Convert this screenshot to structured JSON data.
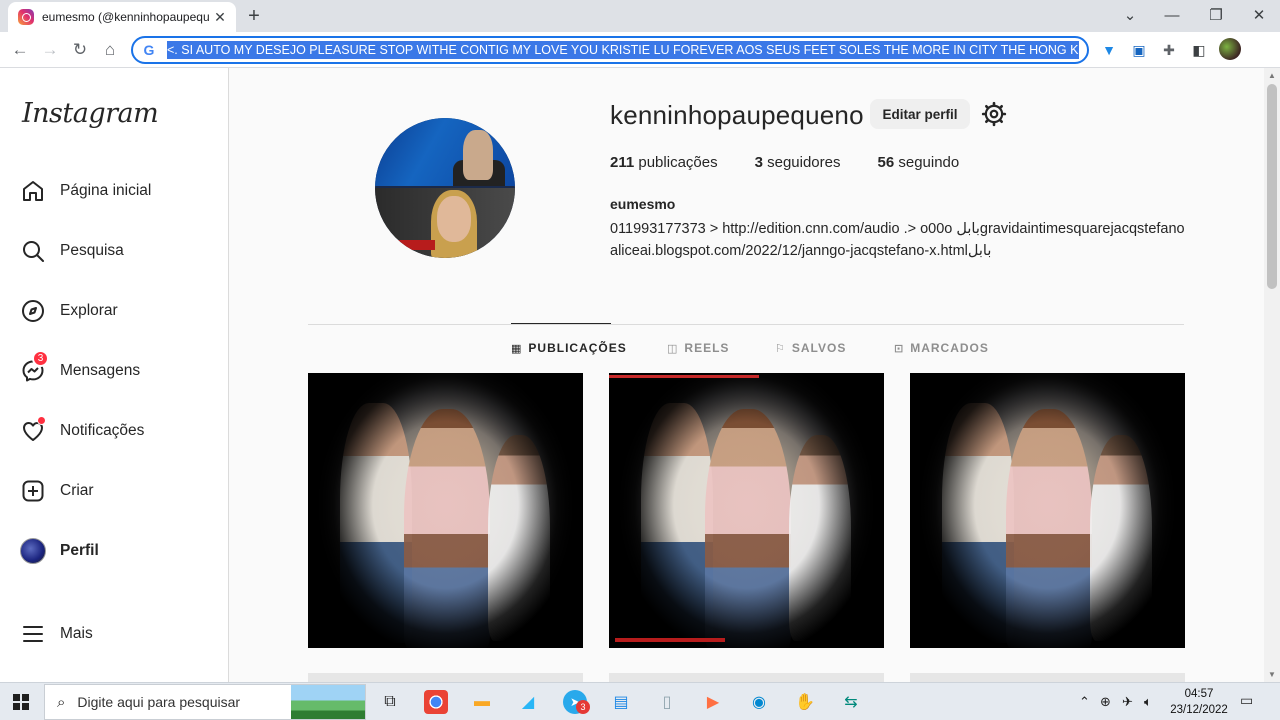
{
  "browser": {
    "tab_title": "eumesmo (@kenninhopaupeque",
    "tab_close": "✕",
    "new_tab": "+",
    "address": "<. SI AUTO MY DESEJO PLEASURE STOP WITHE CONTIG MY LOVE YOU KRISTIE LU FOREVER AOS SEUS FEET SOLES THE MORE IN CITY THE HONG KONG PRIN",
    "g_letter": "G"
  },
  "sidebar": {
    "logo": "Instagram",
    "items": [
      {
        "label": "Página inicial",
        "icon": "home-icon"
      },
      {
        "label": "Pesquisa",
        "icon": "search-icon"
      },
      {
        "label": "Explorar",
        "icon": "compass-icon"
      },
      {
        "label": "Mensagens",
        "icon": "messenger-icon",
        "badge": "3"
      },
      {
        "label": "Notificações",
        "icon": "heart-icon"
      },
      {
        "label": "Criar",
        "icon": "plus-square-icon"
      },
      {
        "label": "Perfil",
        "icon": "avatar"
      },
      {
        "label": "Mais",
        "icon": "menu-icon"
      }
    ]
  },
  "profile": {
    "username": "kenninhopaupequeno",
    "edit_button": "Editar perfil",
    "stats": {
      "posts_count": "211",
      "posts_label": "publicações",
      "followers_count": "3",
      "followers_label": "seguidores",
      "following_count": "56",
      "following_label": "seguindo"
    },
    "full_name": "eumesmo",
    "bio": "011993177373 > http://edition.cnn.com/audio .> o00o بابلgravidaintimesquarejacqstefanoaliceai.blogspot.com/2022/12/janngo-jacqstefano-x.htmlبابل"
  },
  "tabs": [
    {
      "label": "PUBLICAÇÕES",
      "icon": "▦",
      "active": true
    },
    {
      "label": "REELS",
      "icon": "◫",
      "active": false
    },
    {
      "label": "SALVOS",
      "icon": "⚐",
      "active": false
    },
    {
      "label": "MARCADOS",
      "icon": "⊡",
      "active": false
    }
  ],
  "taskbar": {
    "search_placeholder": "Digite aqui para pesquisar",
    "telegram_badge": "3",
    "time": "04:57",
    "date": "23/12/2022"
  },
  "colors": {
    "accent": "#1a73e8",
    "badge": "#ff3040",
    "border": "#dbdbdb"
  }
}
